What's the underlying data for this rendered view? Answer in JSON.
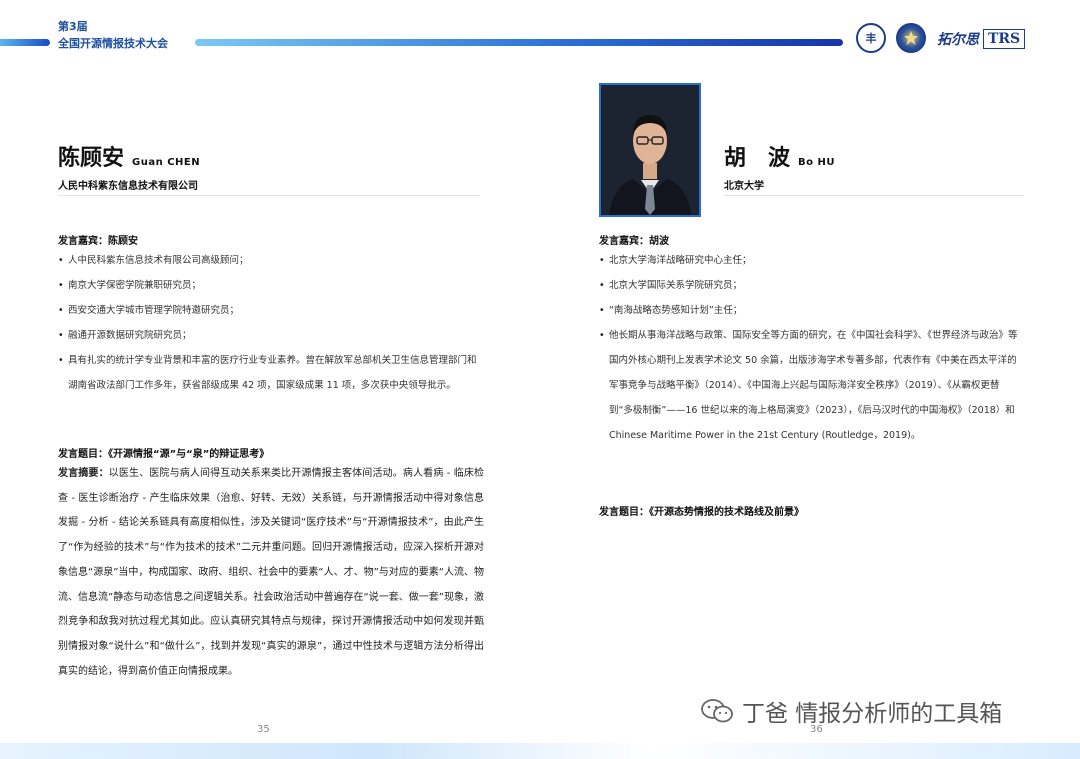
{
  "header": {
    "edition": "第3届",
    "conference": "全国开源情报技术大会",
    "logo1_text": "丰",
    "logo2_text": "",
    "logo3_cn": "拓尔思",
    "logo3_en": "TRS"
  },
  "left": {
    "name_cn": "陈顾安",
    "name_en": "Guan CHEN",
    "org": "人民中科紫东信息技术有限公司",
    "speaker_label": "发言嘉宾：陈顾安",
    "bullets": [
      "人中民科紫东信息技术有限公司高级顾问；",
      "南京大学保密学院兼职研究员；",
      "西安交通大学城市管理学院特邀研究员；",
      "融通开源数据研究院研究员；",
      "具有扎实的统计学专业背景和丰富的医疗行业专业素养。曾在解放军总部机关卫生信息管理部门和湖南省政法部门工作多年，获省部级成果 42 项，国家级成果 11 项，多次获中央领导批示。"
    ],
    "topic_label": "发言题目：《开源情报“源”与“泉”的辩证思考》",
    "abstract_label": "发言摘要：",
    "abstract": "以医生、医院与病人间得互动关系来类比开源情报主客体间活动。病人看病 - 临床检查 - 医生诊断治疗 - 产生临床效果（治愈、好转、无效）关系链，与开源情报活动中得对象信息发掘 - 分析 - 结论关系链具有高度相似性，涉及关键词“医疗技术”与“开源情报技术”，由此产生了“作为经验的技术”与“作为技术的技术”二元并重问题。回归开源情报活动，应深入探析开源对象信息“源泉”当中，构成国家、政府、组织、社会中的要素“人、才、物”与对应的要素“人流、物流、信息流”静态与动态信息之间逻辑关系。社会政治活动中普遍存在“说一套、做一套”现象，激烈竞争和敌我对抗过程尤其如此。应认真研究其特点与规律，探讨开源情报活动中如何发现并甄别情报对象“说什么”和“做什么”，找到并发现“真实的源泉”，通过中性技术与逻辑方法分析得出真实的结论，得到高价值正向情报成果。",
    "page": "35"
  },
  "right": {
    "name_cn": "胡　波",
    "name_en": "Bo HU",
    "org": "北京大学",
    "speaker_label": "发言嘉宾：胡波",
    "bullets": [
      "北京大学海洋战略研究中心主任；",
      "北京大学国际关系学院研究员；",
      "“南海战略态势感知计划”主任；",
      "他长期从事海洋战略与政策、国际安全等方面的研究，在《中国社会科学》、《世界经济与政治》等国内外核心期刊上发表学术论文 50 余篇，出版涉海学术专著多部，代表作有《中美在西太平洋的军事竞争与战略平衡》（2014）、《中国海上兴起与国际海洋安全秩序》（2019）、《从霸权更替到“多极制衡”——16 世纪以来的海上格局演变》（2023），《后马汉时代的中国海权》（2018）和 Chinese Maritime Power in the 21st Century (Routledge，2019)。"
    ],
    "topic_label": "发言题目：《开源态势情报的技术路线及前景》",
    "page": "36"
  },
  "watermark": {
    "text": "丁爸 情报分析师的工具箱",
    "icon": "wechat-icon"
  },
  "colors": {
    "accent": "#1d4fa3",
    "bar_start": "#5ab8ee",
    "bar_end": "#1535a8",
    "photo_border": "#2a6fd0"
  }
}
